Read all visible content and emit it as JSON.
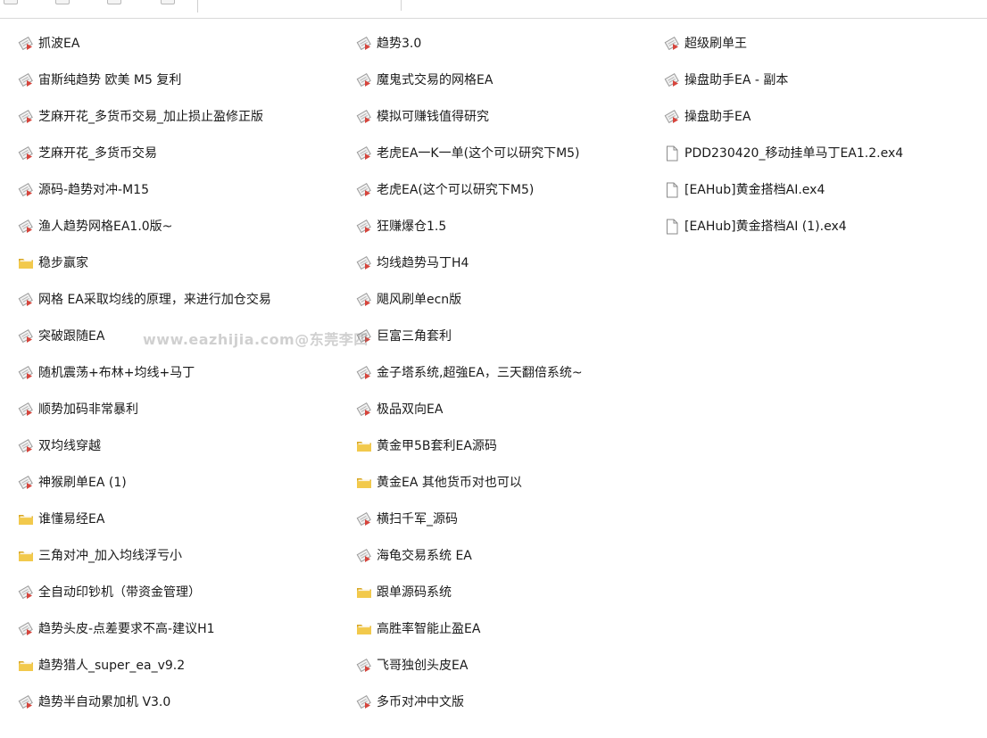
{
  "columns": [
    {
      "items": [
        {
          "name": "抓波EA",
          "icon": "shortcut-file-icon"
        },
        {
          "name": "宙斯纯趋势 欧美 M5 复利",
          "icon": "shortcut-file-icon"
        },
        {
          "name": "芝麻开花_多货币交易_加止损止盈修正版",
          "icon": "shortcut-file-icon"
        },
        {
          "name": "芝麻开花_多货币交易",
          "icon": "shortcut-file-icon"
        },
        {
          "name": "源码-趋势对冲-M15",
          "icon": "shortcut-file-icon"
        },
        {
          "name": "渔人趋势网格EA1.0版~",
          "icon": "shortcut-file-icon"
        },
        {
          "name": "稳步赢家",
          "icon": "folder-icon"
        },
        {
          "name": "网格 EA采取均线的原理，来进行加仓交易",
          "icon": "shortcut-file-icon"
        },
        {
          "name": "突破跟随EA",
          "icon": "shortcut-file-icon"
        },
        {
          "name": "随机震荡+布林+均线+马丁",
          "icon": "shortcut-file-icon"
        },
        {
          "name": "顺势加码非常暴利",
          "icon": "shortcut-file-icon"
        },
        {
          "name": "双均线穿越",
          "icon": "shortcut-file-icon"
        },
        {
          "name": "神猴刷单EA (1)",
          "icon": "shortcut-file-icon"
        },
        {
          "name": "谁懂易经EA",
          "icon": "folder-icon"
        },
        {
          "name": "三角对冲_加入均线浮亏小",
          "icon": "folder-icon"
        },
        {
          "name": "全自动印钞机（带资金管理）",
          "icon": "shortcut-file-icon"
        },
        {
          "name": "趋势头皮-点差要求不高-建议H1",
          "icon": "shortcut-file-icon"
        },
        {
          "name": "趋势猎人_super_ea_v9.2",
          "icon": "folder-icon"
        },
        {
          "name": "趋势半自动累加机 V3.0",
          "icon": "shortcut-file-icon"
        }
      ]
    },
    {
      "items": [
        {
          "name": "趋势3.0",
          "icon": "shortcut-file-icon"
        },
        {
          "name": "魔鬼式交易的网格EA",
          "icon": "shortcut-file-icon"
        },
        {
          "name": "模拟可赚钱值得研究",
          "icon": "shortcut-file-icon"
        },
        {
          "name": "老虎EA一K一单(这个可以研究下M5)",
          "icon": "shortcut-file-icon"
        },
        {
          "name": "老虎EA(这个可以研究下M5)",
          "icon": "shortcut-file-icon"
        },
        {
          "name": "狂赚爆仓1.5",
          "icon": "shortcut-file-icon"
        },
        {
          "name": "均线趋势马丁H4",
          "icon": "shortcut-file-icon"
        },
        {
          "name": "飓风刷单ecn版",
          "icon": "shortcut-file-icon"
        },
        {
          "name": "巨富三角套利",
          "icon": "shortcut-file-icon"
        },
        {
          "name": "金子塔系统,超強EA，三天翻倍系统~",
          "icon": "shortcut-file-icon"
        },
        {
          "name": "极品双向EA",
          "icon": "shortcut-file-icon"
        },
        {
          "name": "黄金甲5B套利EA源码",
          "icon": "folder-icon"
        },
        {
          "name": "黄金EA 其他货币对也可以",
          "icon": "folder-icon"
        },
        {
          "name": "横扫千军_源码",
          "icon": "shortcut-file-icon"
        },
        {
          "name": "海龟交易系统 EA",
          "icon": "shortcut-file-icon"
        },
        {
          "name": "跟单源码系统",
          "icon": "folder-icon"
        },
        {
          "name": "高胜率智能止盈EA",
          "icon": "folder-icon"
        },
        {
          "name": "飞哥独创头皮EA",
          "icon": "shortcut-file-icon"
        },
        {
          "name": "多币对冲中文版",
          "icon": "shortcut-file-icon"
        }
      ]
    },
    {
      "items": [
        {
          "name": "超级刷单王",
          "icon": "shortcut-file-icon"
        },
        {
          "name": "操盘助手EA - 副本",
          "icon": "shortcut-file-icon"
        },
        {
          "name": "操盘助手EA",
          "icon": "shortcut-file-icon"
        },
        {
          "name": "PDD230420_移动挂单马丁EA1.2.ex4",
          "icon": "blank-file-icon"
        },
        {
          "name": "[EAHub]黄金搭档AI.ex4",
          "icon": "blank-file-icon"
        },
        {
          "name": "[EAHub]黄金搭档AI (1).ex4",
          "icon": "blank-file-icon"
        }
      ]
    }
  ],
  "watermark": "www.eazhijia.com@东莞李四",
  "colors": {
    "folder": "#f2c94c",
    "folder_dark": "#d9a823",
    "shortcut_arrow": "#d6453d",
    "file_outline": "#8a8a8a",
    "text": "#1a1a1a"
  }
}
